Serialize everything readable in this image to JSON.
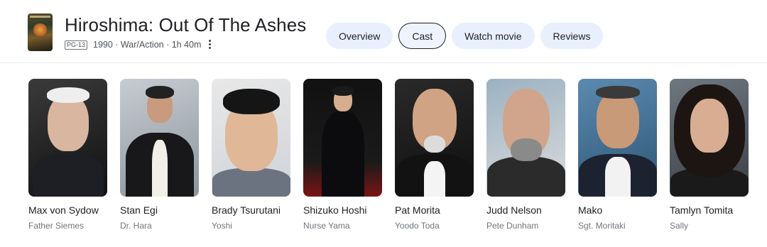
{
  "movie": {
    "title": "Hiroshima: Out Of The Ashes",
    "rating": "PG-13",
    "info": "1990 · War/Action · 1h 40m"
  },
  "icons": {
    "more": "more-vert-icon",
    "poster": "movie-poster"
  },
  "tabs": [
    {
      "label": "Overview",
      "active": false
    },
    {
      "label": "Cast",
      "active": true
    },
    {
      "label": "Watch movie",
      "active": false
    },
    {
      "label": "Reviews",
      "active": false
    }
  ],
  "cast": [
    {
      "name": "Max von Sydow",
      "role": "Father Siemes"
    },
    {
      "name": "Stan Egi",
      "role": "Dr. Hara"
    },
    {
      "name": "Brady Tsurutani",
      "role": "Yoshi"
    },
    {
      "name": "Shizuko Hoshi",
      "role": "Nurse Yama"
    },
    {
      "name": "Pat Morita",
      "role": "Yoodo Toda"
    },
    {
      "name": "Judd Nelson",
      "role": "Pete Dunham"
    },
    {
      "name": "Mako",
      "role": "Sgt. Moritaki"
    },
    {
      "name": "Tamlyn Tomita",
      "role": "Sally"
    }
  ],
  "colors": {
    "tab_bg": "#e8f0fe",
    "text_primary": "#202124",
    "text_secondary": "#70757a"
  }
}
